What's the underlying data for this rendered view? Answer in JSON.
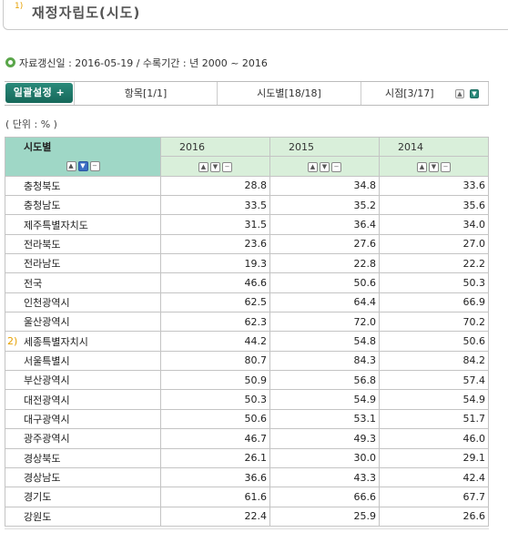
{
  "header": {
    "footnote_marker": "1)",
    "title": "재정자립도(시도)"
  },
  "info": {
    "text": "자료갱신일 : 2016-05-19 / 수록기간 : 년 2000 ~ 2016"
  },
  "toolbar": {
    "batch_button": "일괄설정 +",
    "tabs": [
      "항목[1/1]",
      "시도별[18/18]",
      "시점[3/17]"
    ]
  },
  "unit_label": "( 단위 : % )",
  "table": {
    "headers": [
      "시도별",
      "2016",
      "2015",
      "2014"
    ],
    "rows": [
      {
        "name": "충청북도",
        "v": [
          "28.8",
          "34.8",
          "33.6"
        ]
      },
      {
        "name": "충청남도",
        "v": [
          "33.5",
          "35.2",
          "35.6"
        ]
      },
      {
        "name": "제주특별자치도",
        "v": [
          "31.5",
          "36.4",
          "34.0"
        ]
      },
      {
        "name": "전라북도",
        "v": [
          "23.6",
          "27.6",
          "27.0"
        ]
      },
      {
        "name": "전라남도",
        "v": [
          "19.3",
          "22.8",
          "22.2"
        ]
      },
      {
        "name": "전국",
        "v": [
          "46.6",
          "50.6",
          "50.3"
        ]
      },
      {
        "name": "인천광역시",
        "v": [
          "62.5",
          "64.4",
          "66.9"
        ]
      },
      {
        "name": "울산광역시",
        "v": [
          "62.3",
          "72.0",
          "70.2"
        ]
      },
      {
        "name": "세종특별자치시",
        "marker": "2)",
        "v": [
          "44.2",
          "54.8",
          "50.6"
        ]
      },
      {
        "name": "서울특별시",
        "v": [
          "80.7",
          "84.3",
          "84.2"
        ]
      },
      {
        "name": "부산광역시",
        "v": [
          "50.9",
          "56.8",
          "57.4"
        ]
      },
      {
        "name": "대전광역시",
        "v": [
          "50.3",
          "54.9",
          "54.9"
        ]
      },
      {
        "name": "대구광역시",
        "v": [
          "50.6",
          "53.1",
          "51.7"
        ]
      },
      {
        "name": "광주광역시",
        "v": [
          "46.7",
          "49.3",
          "46.0"
        ]
      },
      {
        "name": "경상북도",
        "v": [
          "26.1",
          "30.0",
          "29.1"
        ]
      },
      {
        "name": "경상남도",
        "v": [
          "36.6",
          "43.3",
          "42.4"
        ]
      },
      {
        "name": "경기도",
        "v": [
          "61.6",
          "66.6",
          "67.7"
        ]
      },
      {
        "name": "강원도",
        "v": [
          "22.4",
          "25.9",
          "26.6"
        ]
      }
    ]
  },
  "colors": {
    "accent": "#16685a",
    "header_first": "#9fd7c6",
    "header_year": "#d9efda",
    "footnote": "#e6a000"
  },
  "icons": {
    "sort_asc": "triangle-up",
    "sort_desc": "triangle-down",
    "reset": "minus"
  }
}
